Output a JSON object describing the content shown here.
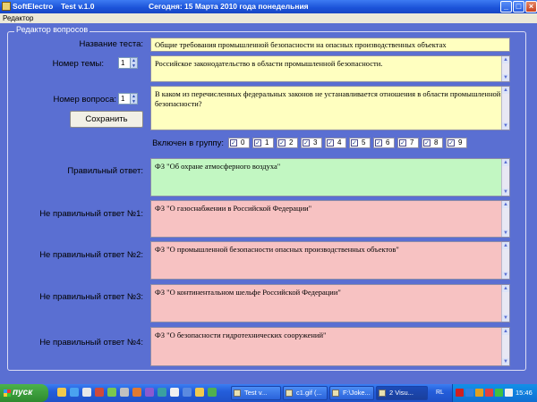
{
  "window": {
    "title_app": "SoftElectro",
    "title_version": "Test v.1.0",
    "title_date": "Сегодня: 15 Марта  2010 года  понедельния"
  },
  "menu": {
    "items": [
      "Редактор"
    ]
  },
  "editor": {
    "group_title": "Редактор вопросов",
    "test_name_label": "Название теста:",
    "test_name_value": "Общие требования промышленной безопасности на опасных производственных объектах",
    "topic_number_label": "Номер темы:",
    "topic_number_value": "1",
    "topic_text": "Российское законодательство в области промышленной безопасности.",
    "question_number_label": "Номер вопроса:",
    "question_number_value": "1",
    "question_text": "В каком из перечисленных федеральных законов не устанавливается отношения в области промышленной безопасности?",
    "save_label": "Сохранить",
    "groups_label": "Включен в группу:",
    "groups": [
      {
        "n": "0",
        "checked": true
      },
      {
        "n": "1",
        "checked": true
      },
      {
        "n": "2",
        "checked": true
      },
      {
        "n": "3",
        "checked": true
      },
      {
        "n": "4",
        "checked": true
      },
      {
        "n": "5",
        "checked": true
      },
      {
        "n": "6",
        "checked": true
      },
      {
        "n": "7",
        "checked": true
      },
      {
        "n": "8",
        "checked": true
      },
      {
        "n": "9",
        "checked": true
      }
    ],
    "correct_label": "Правильный ответ:",
    "correct_value": "ФЗ \"Об охране атмосферного воздуха\"",
    "wrong1_label": "Не  правильный ответ №1:",
    "wrong1_value": "ФЗ \"О газоснабжении в Российской Федерации\"",
    "wrong2_label": "Не правильный ответ №2:",
    "wrong2_value": "ФЗ \"О промышленной безопасности опасных производственных объектов\"",
    "wrong3_label": "Не правильный ответ №3:",
    "wrong3_value": "ФЗ \"О континентальном шельфе Российской Федерации\"",
    "wrong4_label": "Не правильный ответ №4:",
    "wrong4_value": "ФЗ \"О безопасности гидротехнических сооружений\""
  },
  "taskbar": {
    "start_label": "пуск",
    "tasks": [
      "Test v...",
      "c1.gif (...",
      "F:\\Joke...",
      "2 Visu..."
    ],
    "tray_lang": "RL",
    "clock": "15:46"
  },
  "colors": {
    "form_bg": "#5a6fd2",
    "field_yellow": "#ffffc0",
    "field_green": "#c2f7c2",
    "field_pink": "#f7c2c2"
  }
}
